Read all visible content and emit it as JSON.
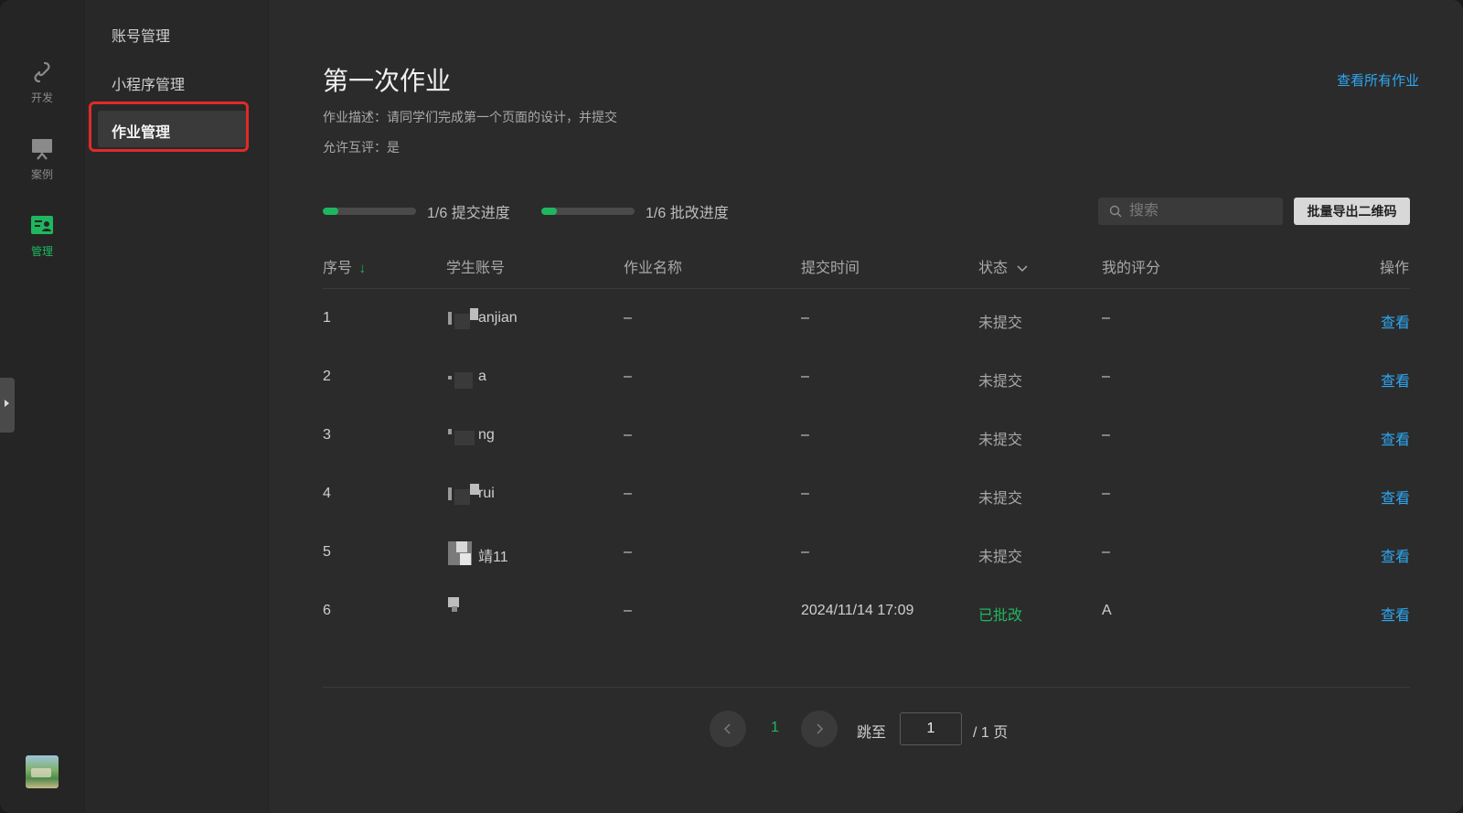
{
  "rail": {
    "items": [
      {
        "label": "开发",
        "icon": "link-icon",
        "active": false
      },
      {
        "label": "案例",
        "icon": "monitor-icon",
        "active": false
      },
      {
        "label": "管理",
        "icon": "manage-icon",
        "active": true
      }
    ],
    "accent": "#1fb75e"
  },
  "subnav": {
    "items": [
      {
        "label": "账号管理"
      },
      {
        "label": "小程序管理"
      },
      {
        "label": "作业管理",
        "active": true
      }
    ]
  },
  "main": {
    "title": "第一次作业",
    "view_all": "查看所有作业",
    "description": "作业描述：请同学们完成第一个页面的设计，并提交",
    "peer_review": "允许互评：是",
    "submit_progress": {
      "text": "1/6 提交进度",
      "fraction": 0.167
    },
    "review_progress": {
      "text": "1/6 批改进度",
      "fraction": 0.167
    },
    "search_placeholder": "搜索",
    "export_button": "批量导出二维码"
  },
  "table": {
    "headers": {
      "index": "序号",
      "account": "学生账号",
      "homework": "作业名称",
      "time": "提交时间",
      "status": "状态",
      "score": "我的评分",
      "action": "操作"
    },
    "rows": [
      {
        "index": "1",
        "account": "anjian",
        "homework": "–",
        "time": "–",
        "status": "未提交",
        "score": "–",
        "action": "查看"
      },
      {
        "index": "2",
        "account": "a",
        "homework": "–",
        "time": "–",
        "status": "未提交",
        "score": "–",
        "action": "查看"
      },
      {
        "index": "3",
        "account": "ng",
        "homework": "–",
        "time": "–",
        "status": "未提交",
        "score": "–",
        "action": "查看"
      },
      {
        "index": "4",
        "account": "rui",
        "homework": "–",
        "time": "–",
        "status": "未提交",
        "score": "–",
        "action": "查看"
      },
      {
        "index": "5",
        "account": "靖11",
        "homework": "–",
        "time": "–",
        "status": "未提交",
        "score": "–",
        "action": "查看"
      },
      {
        "index": "6",
        "account": "",
        "homework": "–",
        "time": "2024/11/14 17:09",
        "status": "已批改",
        "score": "A",
        "action": "查看"
      }
    ]
  },
  "pagination": {
    "current": "1",
    "jump_label": "跳至",
    "jump_value": "1",
    "total": "/ 1 页"
  },
  "colors": {
    "link": "#2ea7f2",
    "success": "#1fb75e",
    "highlight": "#e02a2a"
  }
}
